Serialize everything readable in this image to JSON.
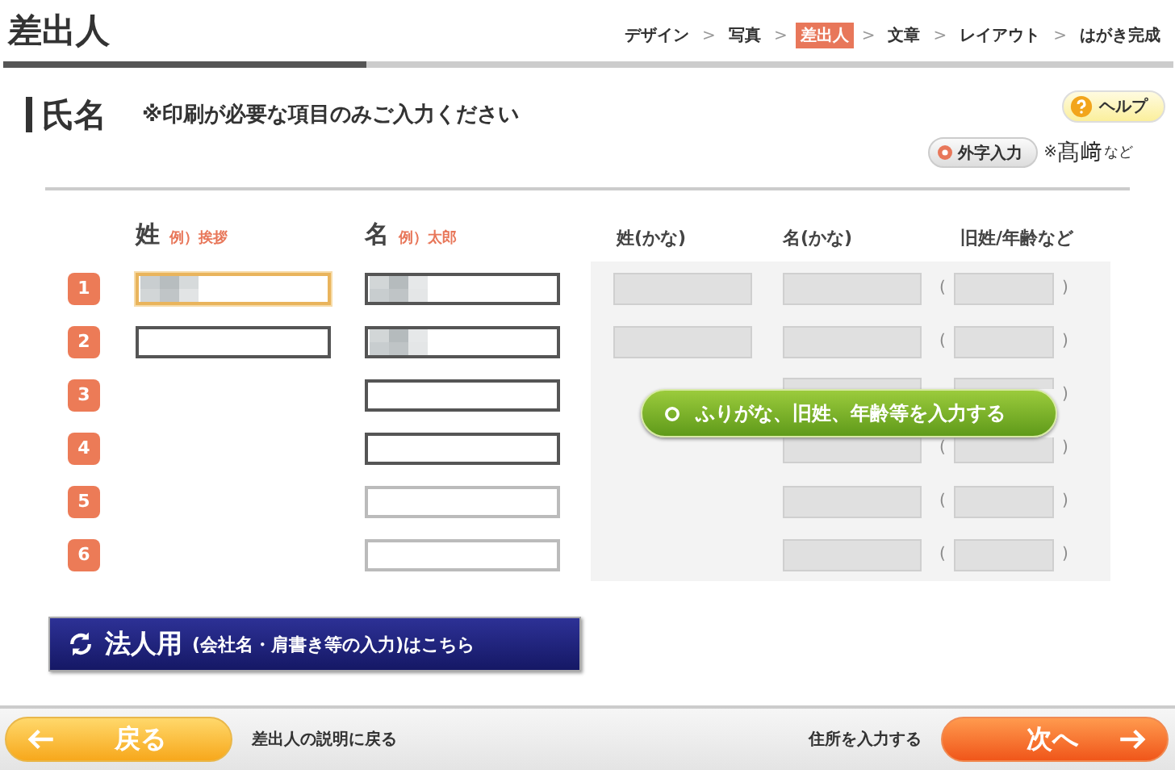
{
  "header": {
    "title": "差出人",
    "steps": [
      {
        "label": "デザイン",
        "selected": false
      },
      {
        "label": "写真",
        "selected": false
      },
      {
        "label": "差出人",
        "selected": true
      },
      {
        "label": "文章",
        "selected": false
      },
      {
        "label": "レイアウト",
        "selected": false
      },
      {
        "label": "はがき完成",
        "selected": false
      }
    ],
    "separator": ">",
    "progress": {
      "level": 0.31
    }
  },
  "section": {
    "title": "氏名",
    "note": "※印刷が必要な項目のみご入力ください",
    "help_button": "ヘルプ",
    "gaiji_button": "外字入力",
    "gaiji_note": "※",
    "gaiji_example": "髙﨑",
    "gaiji_suffix": "など"
  },
  "columns": {
    "sei": "姓",
    "sei_example": "例）挨拶",
    "mei": "名",
    "mei_example": "例）太郎",
    "kana_sei": "姓(かな)",
    "kana_mei": "名(かな)",
    "former": "旧姓/年齢など",
    "paren_open": "(",
    "paren_close": ")"
  },
  "rows": [
    {
      "number": "1",
      "sei": {
        "blurred": true,
        "focused": true
      },
      "mei": {
        "blurred": true,
        "focused": false
      },
      "mei_disabled": false,
      "kana_sei": true
    },
    {
      "number": "2",
      "sei": {
        "blurred": false,
        "focused": false
      },
      "mei": {
        "blurred": true,
        "focused": false
      },
      "mei_disabled": false,
      "kana_sei": true
    },
    {
      "number": "3",
      "mei": {
        "blurred": false,
        "focused": false
      },
      "mei_disabled": false,
      "kana_sei": false
    },
    {
      "number": "4",
      "mei": {
        "blurred": false,
        "focused": false
      },
      "mei_disabled": false,
      "kana_sei": false
    },
    {
      "number": "5",
      "mei": {
        "blurred": false,
        "focused": false
      },
      "mei_disabled": true,
      "kana_sei": false
    },
    {
      "number": "6",
      "mei": {
        "blurred": false,
        "focused": false
      },
      "mei_disabled": true,
      "kana_sei": false
    }
  ],
  "kana_button": "ふりがな、旧姓、年齢等を入力する",
  "corporate_button": {
    "main": "法人用",
    "sub": "(会社名・肩書き等の入力)はこちら"
  },
  "footer": {
    "back_button": "戻る",
    "back_note": "差出人の説明に戻る",
    "next_note": "住所を入力する",
    "next_button": "次へ"
  }
}
